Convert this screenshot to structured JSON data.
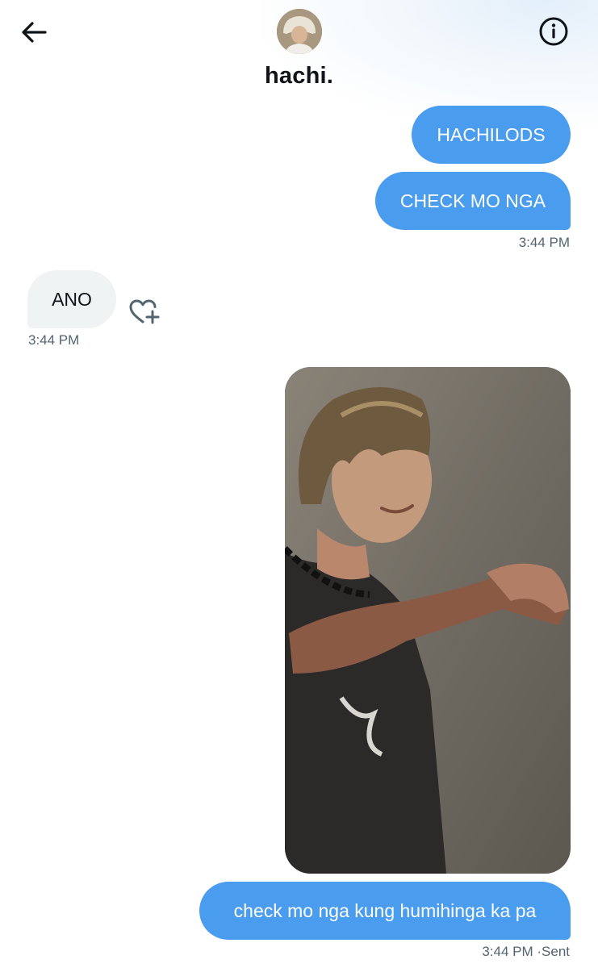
{
  "header": {
    "display_name": "hachi.",
    "back_icon": "arrow-left-icon",
    "info_icon": "info-icon"
  },
  "messages": [
    {
      "direction": "outgoing",
      "text": "HACHILODS"
    },
    {
      "direction": "outgoing",
      "text": "CHECK MO NGA",
      "timestamp": "3:44 PM"
    },
    {
      "direction": "incoming",
      "text": "ANO",
      "timestamp": "3:44 PM",
      "reaction_icon": "heart-plus-icon"
    },
    {
      "direction": "outgoing",
      "type": "photo"
    },
    {
      "direction": "outgoing",
      "text": "check mo nga kung humihinga ka pa",
      "timestamp": "3:44 PM",
      "status": "·Sent"
    }
  ],
  "colors": {
    "outgoing_bubble": "#4a9cee",
    "incoming_bubble": "#eff3f4",
    "timestamp": "#536471"
  }
}
